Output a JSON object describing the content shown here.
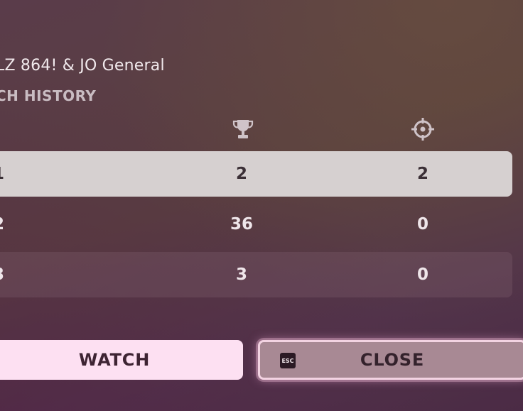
{
  "header": {
    "players": "LZ 864! & JO General",
    "section_title": "CH HISTORY"
  },
  "columns": {
    "trophy_icon": "trophy-icon",
    "eliminations_icon": "crosshair-icon"
  },
  "rows": [
    {
      "rank": "1",
      "trophy": "2",
      "elims": "2",
      "highlighted": true
    },
    {
      "rank": "2",
      "trophy": "36",
      "elims": "0"
    },
    {
      "rank": "3",
      "trophy": "3",
      "elims": "0"
    }
  ],
  "buttons": {
    "watch_label": "WATCH",
    "close_label": "CLOSE",
    "esc_key_label": "ESC"
  },
  "colors": {
    "highlight_row": "#d6d0d0",
    "watch_button": "#fde0f2",
    "close_button": "#a88994",
    "close_border": "#f3d3e2"
  }
}
